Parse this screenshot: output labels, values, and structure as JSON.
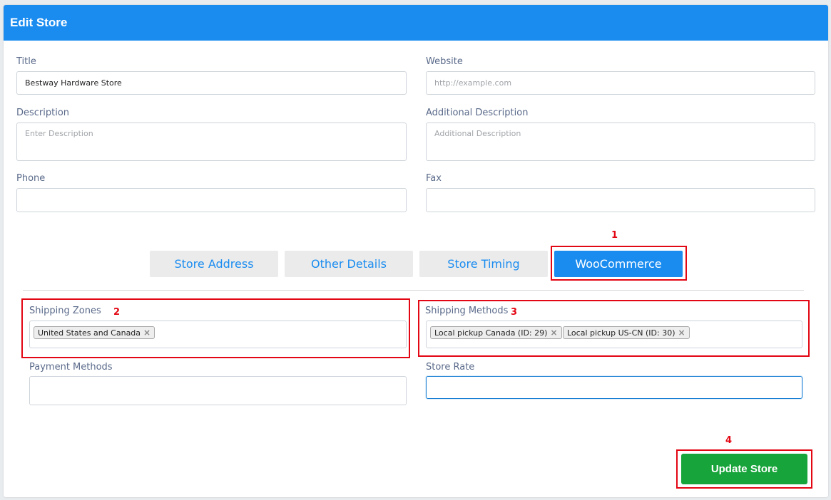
{
  "header": {
    "title": "Edit Store"
  },
  "form": {
    "title": {
      "label": "Title",
      "value": "Bestway Hardware Store"
    },
    "website": {
      "label": "Website",
      "placeholder": "http://example.com"
    },
    "description": {
      "label": "Description",
      "placeholder": "Enter Description"
    },
    "additional_description": {
      "label": "Additional Description",
      "placeholder": "Additional Description"
    },
    "phone": {
      "label": "Phone",
      "value": ""
    },
    "fax": {
      "label": "Fax",
      "value": ""
    }
  },
  "tabs": [
    {
      "label": "Store Address",
      "active": false
    },
    {
      "label": "Other Details",
      "active": false
    },
    {
      "label": "Store Timing",
      "active": false
    },
    {
      "label": "WooCommerce",
      "active": true
    }
  ],
  "woocommerce": {
    "shipping_zones": {
      "label": "Shipping Zones",
      "tags": [
        "United States and Canada"
      ]
    },
    "shipping_methods": {
      "label": "Shipping Methods",
      "tags": [
        "Local pickup Canada (ID: 29)",
        "Local pickup US-CN (ID: 30)"
      ]
    },
    "payment_methods": {
      "label": "Payment Methods",
      "value": ""
    },
    "store_rate": {
      "label": "Store Rate",
      "value": ""
    }
  },
  "annotations": [
    "1",
    "2",
    "3",
    "4"
  ],
  "actions": {
    "update_label": "Update Store"
  },
  "colors": {
    "header": "#1a8cf0",
    "accent": "#1a8cf0",
    "update_button": "#17a43a",
    "annotation": "#e30613"
  }
}
